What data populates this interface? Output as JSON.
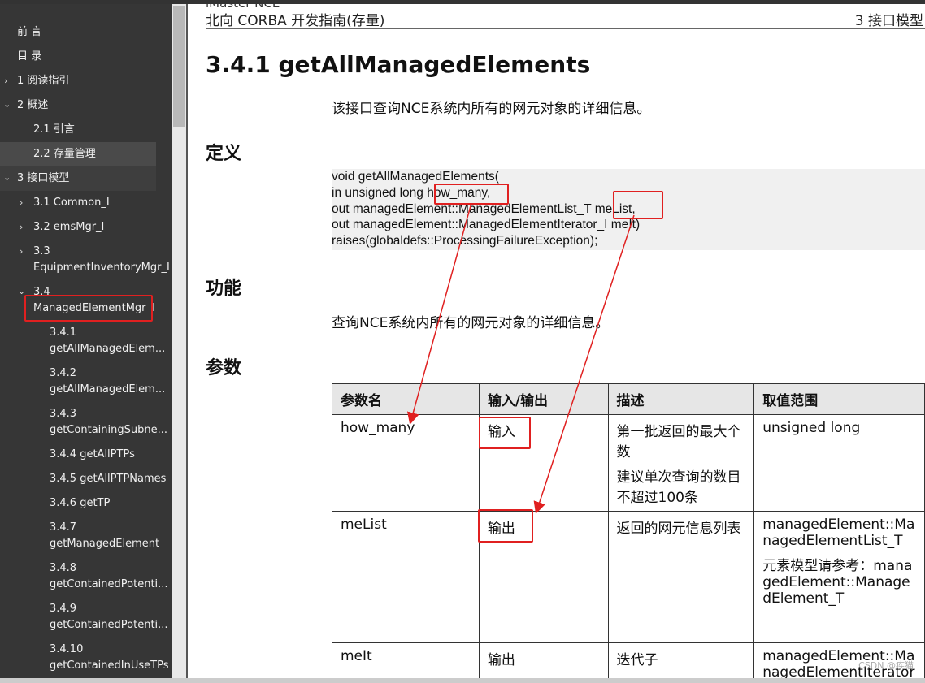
{
  "sidebar": {
    "items": [
      {
        "label": "前 言"
      },
      {
        "label": "目 录"
      },
      {
        "label": "1 阅读指引"
      },
      {
        "label": "2 概述"
      },
      {
        "label": "2.1 引言"
      },
      {
        "label": "2.2 存量管理"
      },
      {
        "label": "3 接口模型"
      },
      {
        "label": "3.1 Common_I"
      },
      {
        "label": "3.2 emsMgr_I"
      },
      {
        "label": "3.3",
        "label2": "EquipmentInventoryMgr_I"
      },
      {
        "label": "3.4",
        "label2": "ManagedElementMgr_I"
      },
      {
        "label": "3.4.1",
        "label2": "getAllManagedElem..."
      },
      {
        "label": "3.4.2",
        "label2": "getAllManagedElem..."
      },
      {
        "label": "3.4.3",
        "label2": "getContainingSubne..."
      },
      {
        "label": "3.4.4 getAllPTPs"
      },
      {
        "label": "3.4.5 getAllPTPNames"
      },
      {
        "label": "3.4.6 getTP"
      },
      {
        "label": "3.4.7",
        "label2": "getManagedElement"
      },
      {
        "label": "3.4.8",
        "label2": "getContainedPotenti..."
      },
      {
        "label": "3.4.9",
        "label2": "getContainedPotenti..."
      },
      {
        "label": "3.4.10",
        "label2": "getContainedInUseTPs"
      }
    ]
  },
  "header": {
    "top_cut": "iMaster NCE",
    "doc_title": "北向 CORBA 开发指南(存量)",
    "chapter": "3 接口模型"
  },
  "main": {
    "heading": "3.4.1 getAllManagedElements",
    "intro": "该接口查询NCE系统内所有的网元对象的详细信息。",
    "def_title": "定义",
    "code_lines": [
      "void getAllManagedElements(",
      "in unsigned long how_many,",
      "out managedElement::ManagedElementList_T meList,",
      "out managedElement::ManagedElementIterator_I meIt)",
      "raises(globaldefs::ProcessingFailureException);"
    ],
    "func_title": "功能",
    "func_desc": "查询NCE系统内所有的网元对象的详细信息。",
    "param_title": "参数",
    "table": {
      "headers": [
        "参数名",
        "输入/输出",
        "描述",
        "取值范围"
      ],
      "rows": [
        {
          "name": "how_many",
          "io": "输入",
          "desc1": "第一批返回的最大个数",
          "desc2": "建议单次查询的数目不超过100条",
          "range1": "unsigned long",
          "range2": ""
        },
        {
          "name": "meList",
          "io": "输出",
          "desc1": "返回的网元信息列表",
          "desc2": "",
          "range1": "managedElement::ManagedElementList_T",
          "range2": "元素模型请参考：managedElement::ManagedElement_T"
        },
        {
          "name": "meIt",
          "io": "输出",
          "desc1": "迭代子",
          "desc2": "",
          "range1": "managedElement::ManagedElementIterator_I",
          "range2": ""
        }
      ]
    }
  },
  "watermark": "CSDN @疾猫",
  "colors": {
    "sidebar_bg": "#363636",
    "highlight": "#e02020",
    "table_header": "#e6e6e6"
  }
}
